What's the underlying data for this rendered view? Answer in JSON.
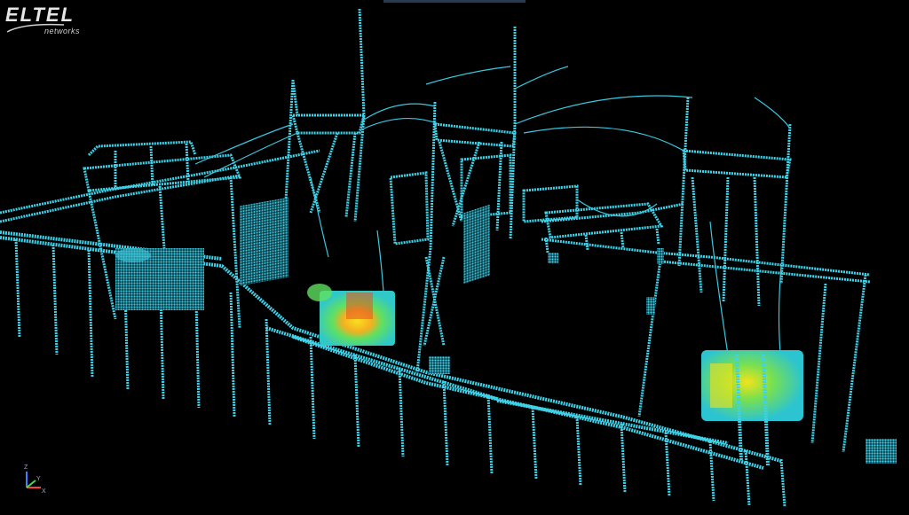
{
  "logo": {
    "main": "ELTEL",
    "sub": "networks"
  },
  "colors": {
    "background": "#000000",
    "structure": "#3fd2e8",
    "structure_dim": "#1f8fb0",
    "transformer_hot": "#f2e31a",
    "transformer_warm": "#58e46a",
    "transformer_red": "#e85020"
  },
  "axes_widget": {
    "x_label": "X",
    "y_label": "Y",
    "z_label": "Z"
  }
}
